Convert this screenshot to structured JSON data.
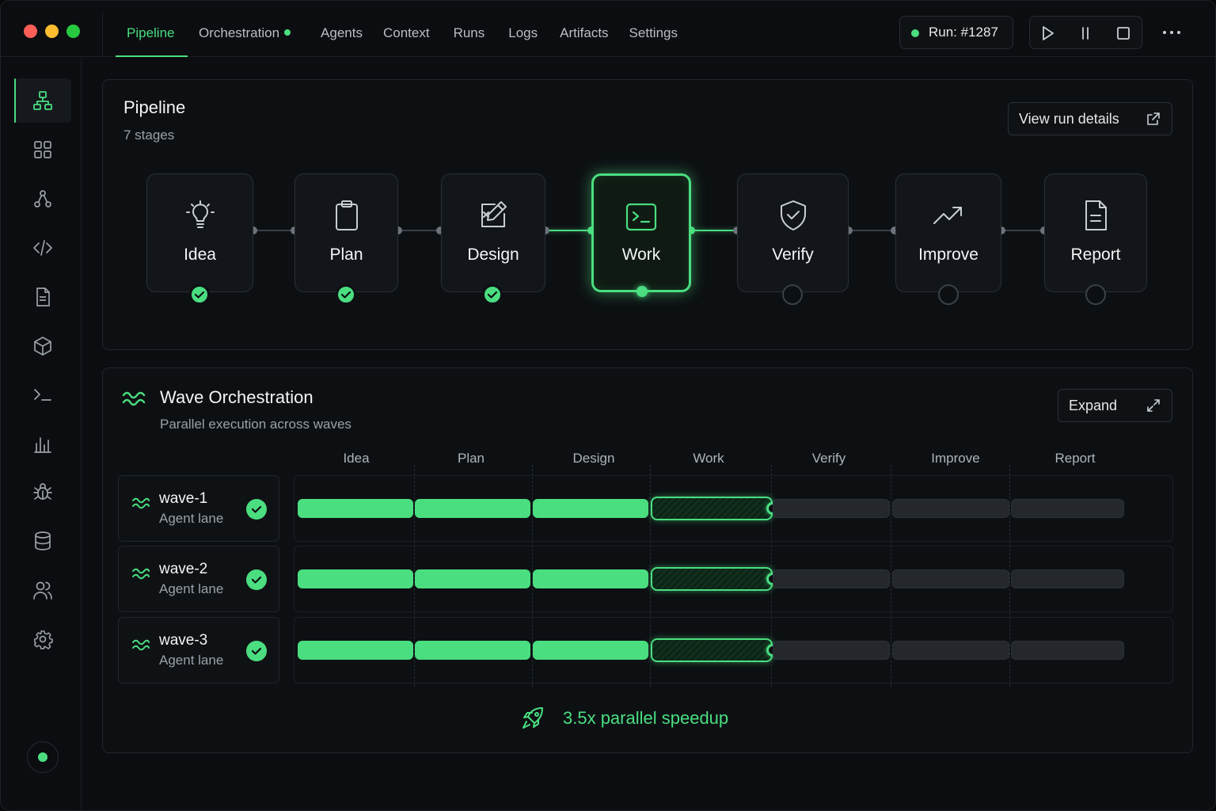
{
  "nav": {
    "tabs": [
      {
        "label": "Pipeline",
        "active": true
      },
      {
        "label": "Orchestration",
        "indicator": true
      },
      {
        "label": "Agents"
      },
      {
        "label": "Context"
      },
      {
        "label": "Runs"
      },
      {
        "label": "Logs"
      },
      {
        "label": "Artifacts"
      },
      {
        "label": "Settings"
      }
    ],
    "run_label": "Run: #1287",
    "controls": [
      "play-icon",
      "pause-icon",
      "stop-icon"
    ]
  },
  "sidebar": {
    "items": [
      "pipeline-icon",
      "grid-icon",
      "agents-icon",
      "code-icon",
      "document-icon",
      "cube-icon",
      "terminal-icon",
      "chart-icon",
      "bug-icon",
      "database-icon",
      "users-icon",
      "settings-icon"
    ],
    "active": "pipeline-icon"
  },
  "pipeline": {
    "title": "Pipeline",
    "subtitle": "7 stages",
    "view_button": "View run details",
    "stages": [
      {
        "label": "Idea",
        "icon": "lightbulb-icon",
        "status": "done"
      },
      {
        "label": "Plan",
        "icon": "clipboard-icon",
        "status": "done"
      },
      {
        "label": "Design",
        "icon": "edit-icon",
        "status": "done"
      },
      {
        "label": "Work",
        "icon": "terminal-icon",
        "status": "active"
      },
      {
        "label": "Verify",
        "icon": "shield-check-icon",
        "status": "pending"
      },
      {
        "label": "Improve",
        "icon": "trending-up-icon",
        "status": "pending"
      },
      {
        "label": "Report",
        "icon": "file-text-icon",
        "status": "pending"
      }
    ]
  },
  "waves": {
    "title": "Wave Orchestration",
    "subtitle": "Parallel execution across waves",
    "expand_button": "Expand",
    "columns": [
      "Idea",
      "Plan",
      "Design",
      "Work",
      "Verify",
      "Improve",
      "Report"
    ],
    "lanes": [
      {
        "name": "wave-1",
        "sub": "Agent lane",
        "status": "done",
        "progress": [
          "done",
          "done",
          "done",
          "active",
          "pending",
          "pending",
          "pending"
        ]
      },
      {
        "name": "wave-2",
        "sub": "Agent lane",
        "status": "done",
        "progress": [
          "done",
          "done",
          "done",
          "active",
          "pending",
          "pending",
          "pending"
        ]
      },
      {
        "name": "wave-3",
        "sub": "Agent lane",
        "status": "done",
        "progress": [
          "done",
          "done",
          "done",
          "active",
          "pending",
          "pending",
          "pending"
        ]
      }
    ],
    "speedup": "3.5x parallel speedup"
  },
  "colors": {
    "accent": "#4ade80",
    "background": "#0b0d10",
    "panel": "#0d1013"
  }
}
